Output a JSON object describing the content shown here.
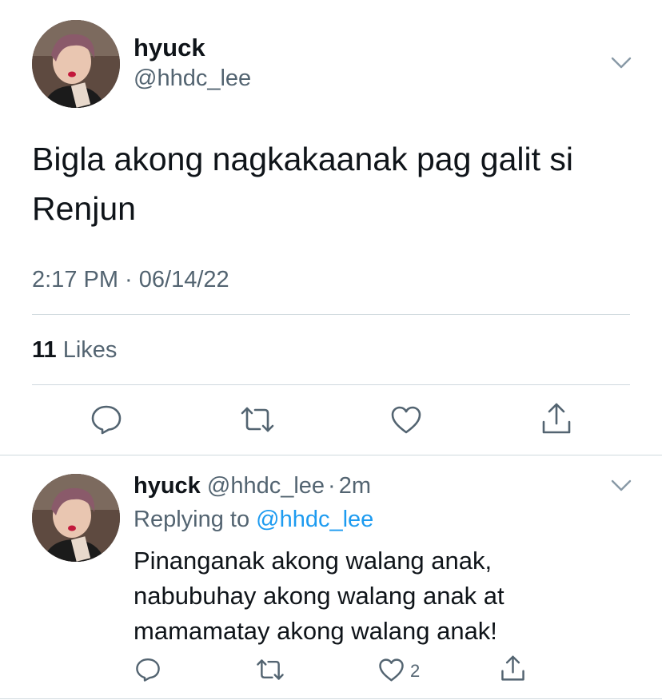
{
  "main_tweet": {
    "display_name": "hyuck",
    "handle": "@hhdc_lee",
    "text_line1": "Bigla akong nagkakaanak pag galit si",
    "text_line2": "Renjun",
    "timestamp": "2:17 PM · 06/14/22",
    "likes_count": "11",
    "likes_label": "Likes",
    "icons": [
      "reply-icon",
      "retweet-icon",
      "like-icon",
      "share-icon",
      "chevron-down-icon"
    ]
  },
  "reply_tweet": {
    "display_name": "hyuck",
    "handle": "@hhdc_lee",
    "separator": "·",
    "time_ago": "2m",
    "replying_prefix": "Replying to",
    "replying_to": "@hhdc_lee",
    "text_lines": [
      "Pinanganak akong walang anak,",
      "nabubuhay akong walang anak at",
      "mamamatay akong walang anak!"
    ],
    "like_count": "2",
    "icons": [
      "reply-icon",
      "retweet-icon",
      "like-icon",
      "share-icon",
      "chevron-down-icon"
    ]
  },
  "colors": {
    "text_primary": "#0f1419",
    "text_secondary": "#536471",
    "link": "#1d9bf0",
    "divider": "#cfd9de"
  }
}
